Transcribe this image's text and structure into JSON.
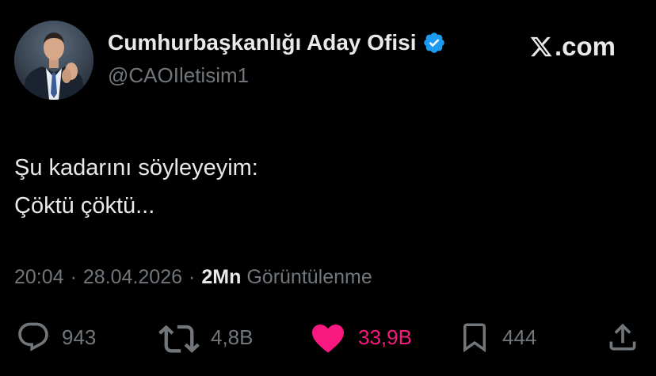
{
  "author": {
    "display_name": "Cumhurbaşkanlığı Aday Ofisi",
    "handle": "@CAOIletisim1",
    "verified": true,
    "avatar_icon": "profile-photo"
  },
  "brand": {
    "icon": "x-logo-icon",
    "text": ".com"
  },
  "tweet": {
    "lines": [
      "Şu kadarını söyleyeyim:",
      "Çöktü çöktü..."
    ]
  },
  "meta": {
    "time": "20:04",
    "separator": "·",
    "date": "28.04.2026",
    "views_count": "2Mn",
    "views_label": "Görüntülenme"
  },
  "actions": {
    "reply": {
      "icon": "reply-icon",
      "count": "943"
    },
    "retweet": {
      "icon": "retweet-icon",
      "count": "4,8B"
    },
    "like": {
      "icon": "heart-icon",
      "count": "33,9B",
      "liked": true
    },
    "bookmark": {
      "icon": "bookmark-icon",
      "count": "444"
    },
    "share": {
      "icon": "share-icon"
    }
  },
  "colors": {
    "background": "#000000",
    "text_primary": "#e7e9ea",
    "text_secondary": "#71767b",
    "verified": "#1d9bf0",
    "like": "#f91880"
  }
}
